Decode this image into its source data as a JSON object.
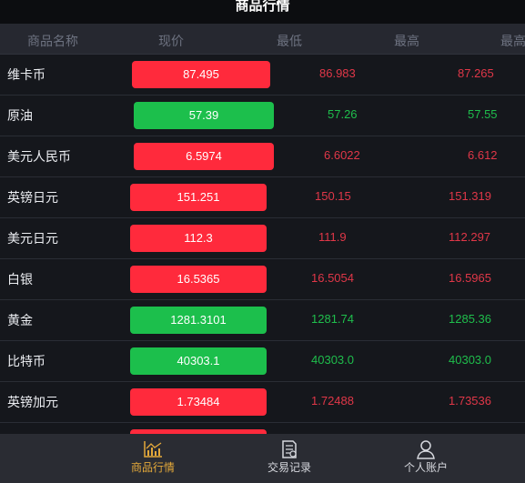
{
  "header": {
    "title": "商品行情"
  },
  "columns": [
    "商品名称",
    "现价",
    "最低",
    "最高",
    "最高"
  ],
  "colors": {
    "up": "#ff2a3c",
    "down": "#1cbf4c",
    "active_tab": "#e4a93a"
  },
  "rows": [
    {
      "name": "维卡币",
      "price": "87.495",
      "low": "86.983",
      "high": "87.265",
      "trend": "red"
    },
    {
      "name": "原油",
      "price": "57.39",
      "low": "57.26",
      "high": "57.55",
      "trend": "green"
    },
    {
      "name": "美元人民币",
      "price": "6.5974",
      "low": "6.6022",
      "high": "6.612",
      "trend": "red"
    },
    {
      "name": "英镑日元",
      "price": "151.251",
      "low": "150.15",
      "high": "151.319",
      "trend": "red"
    },
    {
      "name": "美元日元",
      "price": "112.3",
      "low": "111.9",
      "high": "112.297",
      "trend": "red"
    },
    {
      "name": "白银",
      "price": "16.5365",
      "low": "16.5054",
      "high": "16.5965",
      "trend": "red"
    },
    {
      "name": "黄金",
      "price": "1281.3101",
      "low": "1281.74",
      "high": "1285.36",
      "trend": "green"
    },
    {
      "name": "比特币",
      "price": "40303.1",
      "low": "40303.0",
      "high": "40303.0",
      "trend": "green"
    },
    {
      "name": "英镑加元",
      "price": "1.73484",
      "low": "1.72488",
      "high": "1.73536",
      "trend": "red"
    },
    {
      "name": "",
      "price": "",
      "low": "",
      "high": "",
      "trend": "red"
    }
  ],
  "tabbar": {
    "items": [
      {
        "label": "商品行情",
        "icon": "chart-icon",
        "active": true
      },
      {
        "label": "交易记录",
        "icon": "document-icon",
        "active": false
      },
      {
        "label": "个人账户",
        "icon": "user-icon",
        "active": false
      }
    ]
  }
}
